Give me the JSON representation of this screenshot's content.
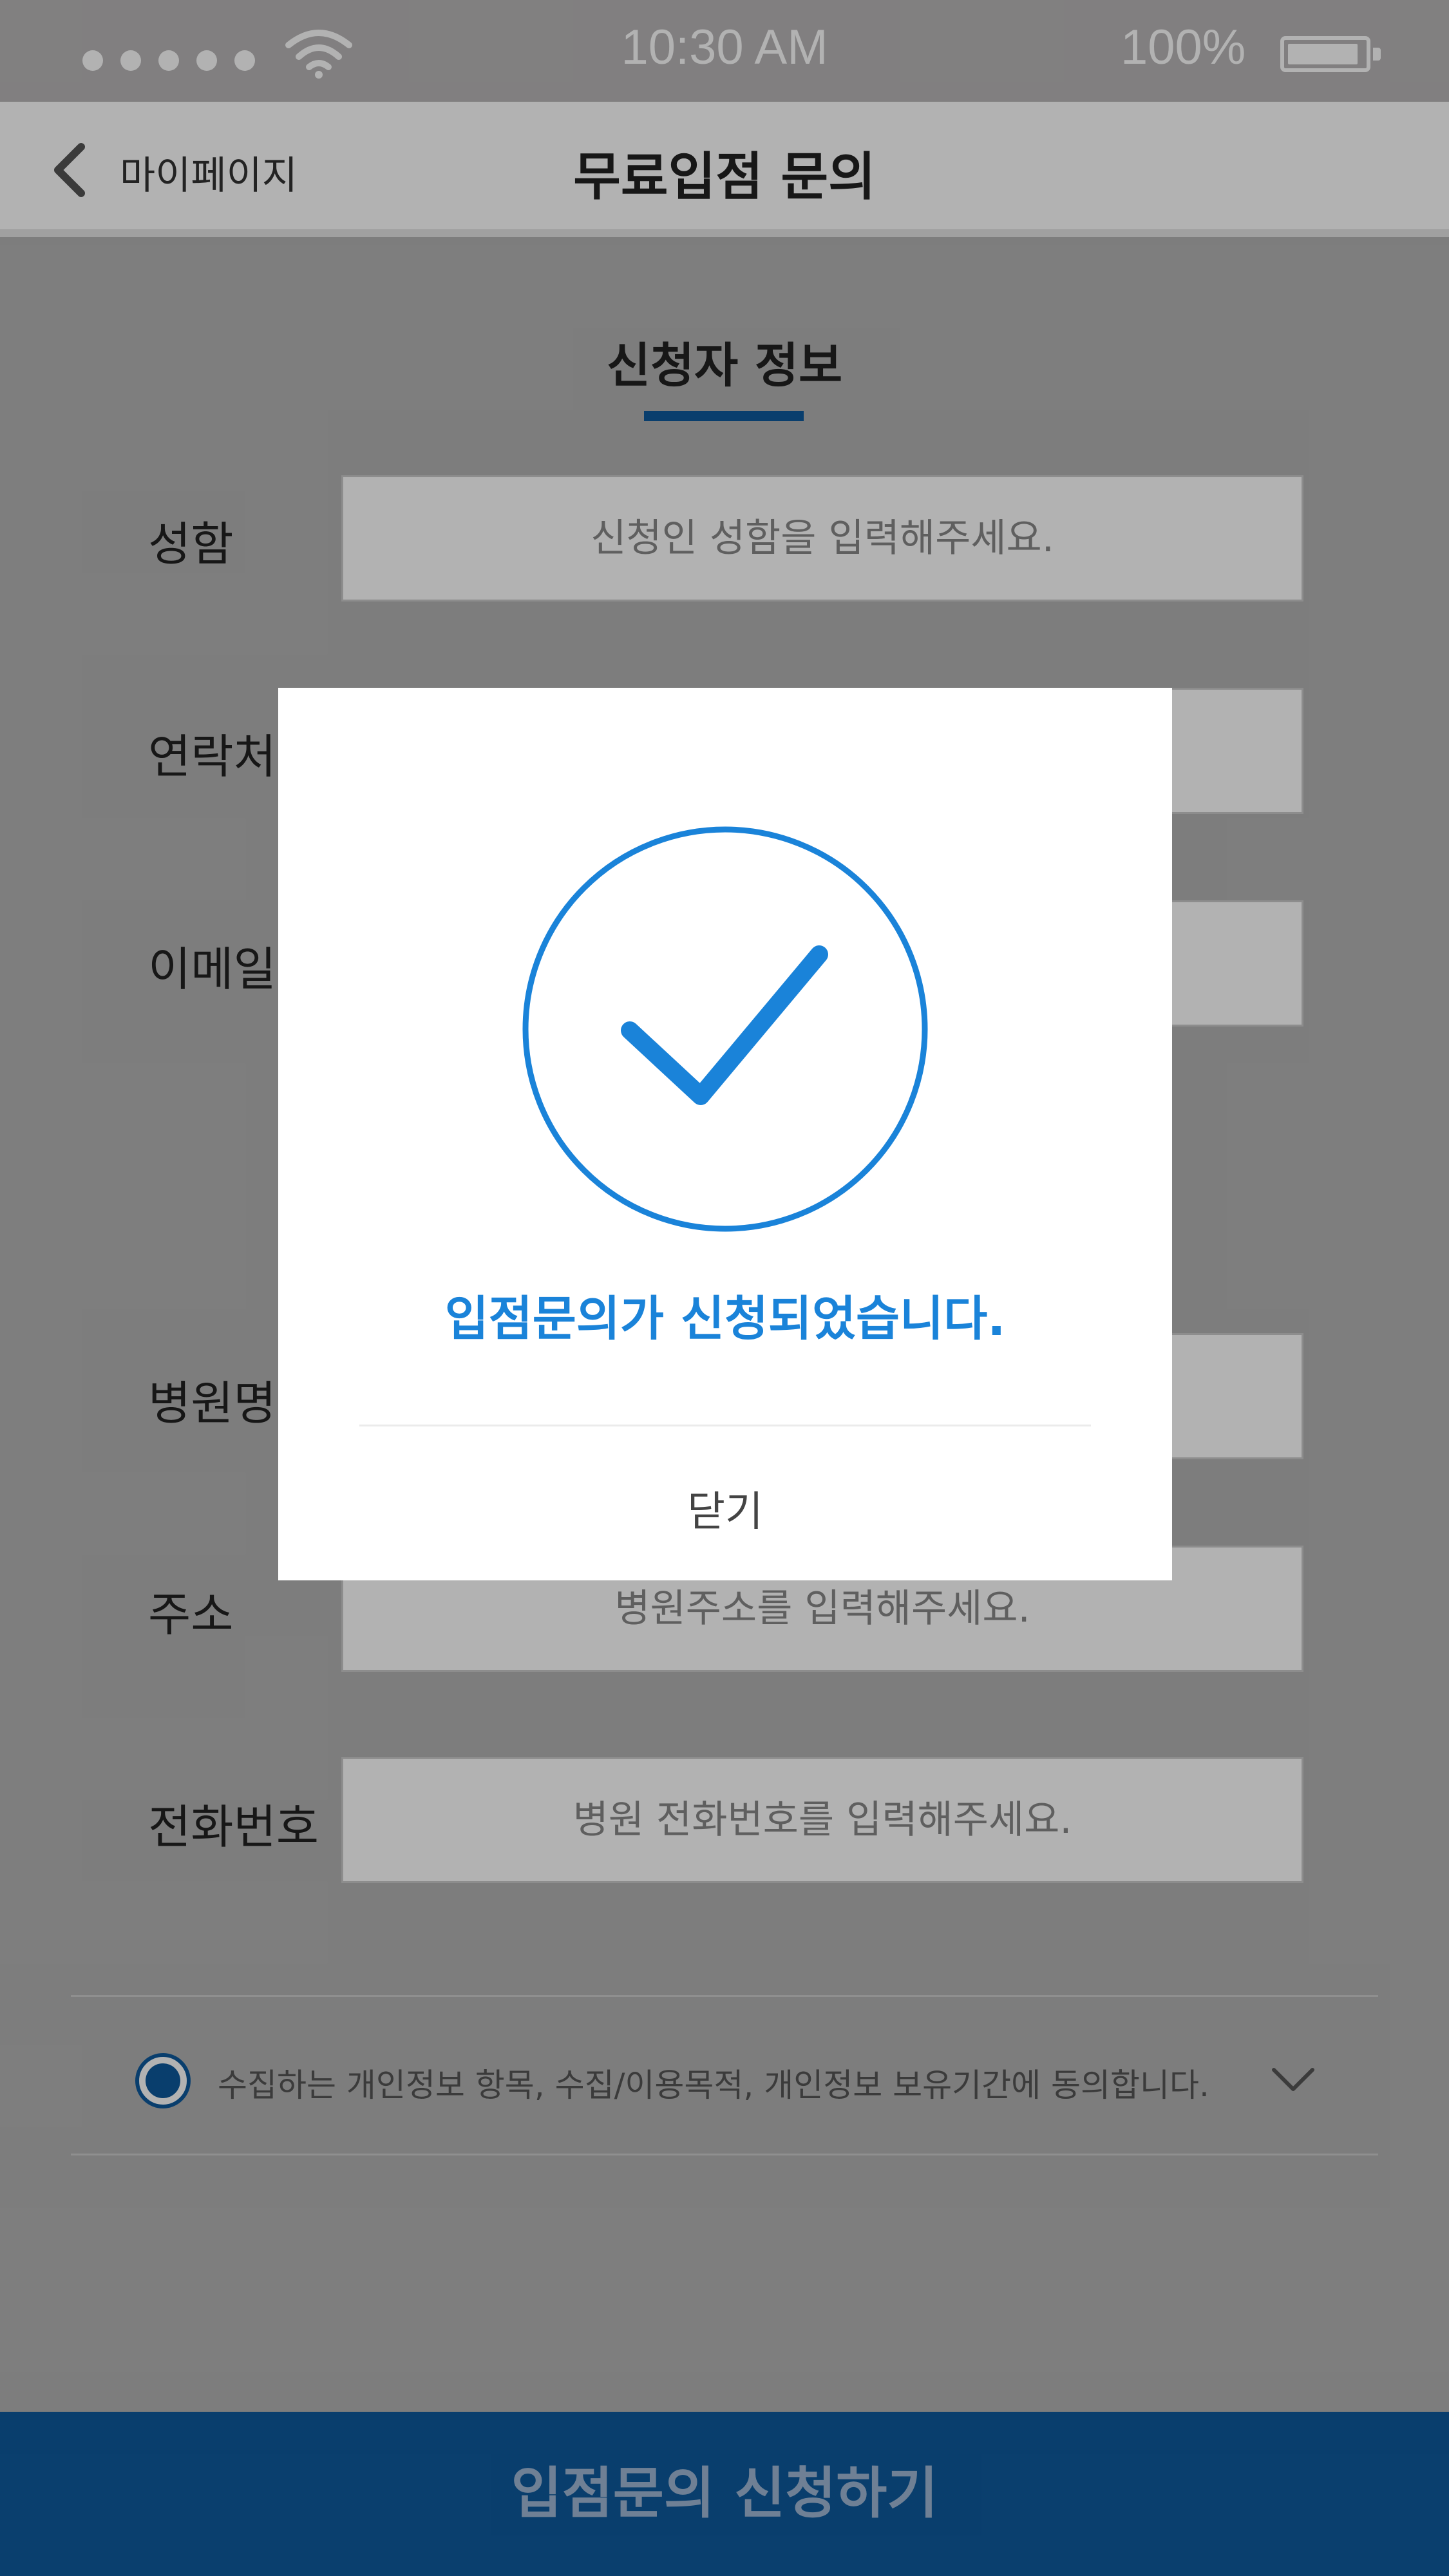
{
  "status_bar": {
    "time": "10:30 AM",
    "battery": "100%",
    "signal_icon": "signal-dots-icon",
    "wifi_icon": "wifi-icon",
    "battery_icon": "battery-icon",
    "battery_level": 1.0
  },
  "header": {
    "back_label": "마이페이지",
    "title": "무료입점 문의"
  },
  "form": {
    "section_title": "신청자 정보",
    "fields": [
      {
        "label": "성함",
        "placeholder": "신청인 성함을 입력해주세요."
      },
      {
        "label": "연락처",
        "placeholder": ""
      },
      {
        "label": "이메일",
        "placeholder": ""
      },
      {
        "label": "병원명",
        "placeholder": ""
      },
      {
        "label": "주소",
        "placeholder": "병원주소를 입력해주세요."
      },
      {
        "label": "전화번호",
        "placeholder": "병원 전화번호를 입력해주세요."
      }
    ],
    "consent_text": "수집하는 개인정보 항목, 수집/이용목적, 개인정보 보유기간에 동의합니다.",
    "consent_checked": true,
    "submit_label": "입점문의 신청하기"
  },
  "modal": {
    "icon": "check-circle-icon",
    "message": "입점문의가 신청되었습니다.",
    "close_label": "닫기"
  },
  "colors": {
    "brand": "#0e5a9d",
    "accent": "#1a83d9",
    "overlay": "rgba(0,0,0,0.30)"
  }
}
